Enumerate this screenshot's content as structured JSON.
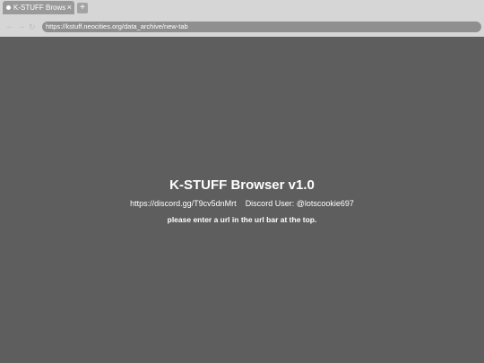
{
  "colors": {
    "chrome_background": "#d6d6d6",
    "tab_background": "#9a9a9a",
    "urlbar_background": "#8f8f8f",
    "page_background": "#5e5e5e",
    "text": "#ffffff"
  },
  "tabs": [
    {
      "title": "K-STUFF Browser",
      "close_glyph": "×",
      "favicon": "globe-icon",
      "active": true
    }
  ],
  "new_tab": {
    "glyph": "+",
    "icon": "plus-icon"
  },
  "toolbar": {
    "back_glyph": "←",
    "forward_glyph": "→",
    "reload_glyph": "↻",
    "url": "https://kstuff.neocities.org/data_archive/new-tab"
  },
  "page": {
    "title": "K-STUFF Browser v1.0",
    "discord_link": "https://discord.gg/T9cv5dnMrt",
    "discord_user": "Discord User: @lotscookie697",
    "prompt": "please enter a url in the url bar at the top."
  }
}
